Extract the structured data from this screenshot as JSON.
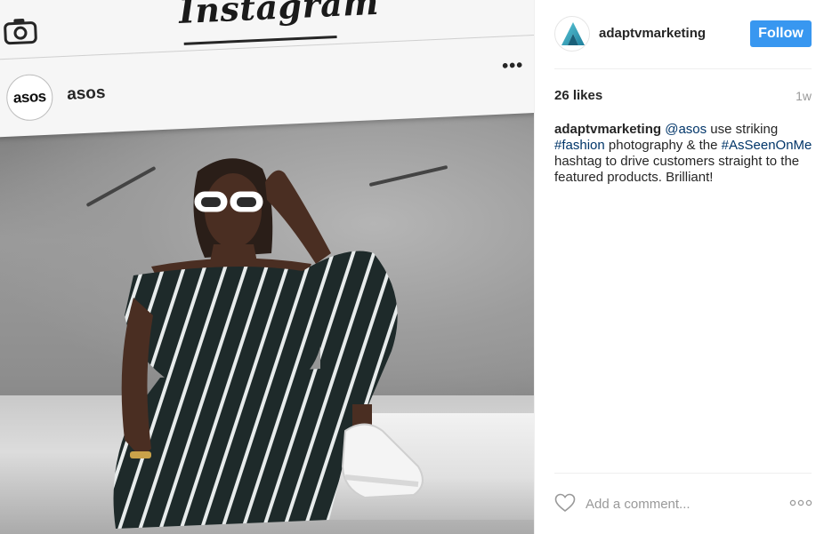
{
  "post": {
    "image": {
      "screen_logo": "Instagram",
      "screen_account": {
        "avatar_text": "asos",
        "name": "asos",
        "more": "•••"
      },
      "icons": [
        "camera-icon",
        "send-icon"
      ]
    },
    "header": {
      "username": "adaptvmarketing",
      "follow_label": "Follow",
      "avatar_icon": "adaptv-logo-icon"
    },
    "meta": {
      "likes": "26 likes",
      "time": "1w"
    },
    "caption": {
      "user": "adaptvmarketing",
      "parts": [
        " ",
        "@asos",
        " use striking ",
        "#fashion",
        " photography & the ",
        "#AsSeenOnMe",
        " hashtag to drive customers straight to the featured products. Brilliant!"
      ]
    },
    "comment_box": {
      "placeholder": "Add a comment...",
      "like_icon": "heart-icon",
      "options_icon": "more-options-icon"
    },
    "colors": {
      "follow_button": "#3897f0",
      "link": "#003569",
      "muted": "#999999",
      "divider": "#efefef"
    }
  }
}
